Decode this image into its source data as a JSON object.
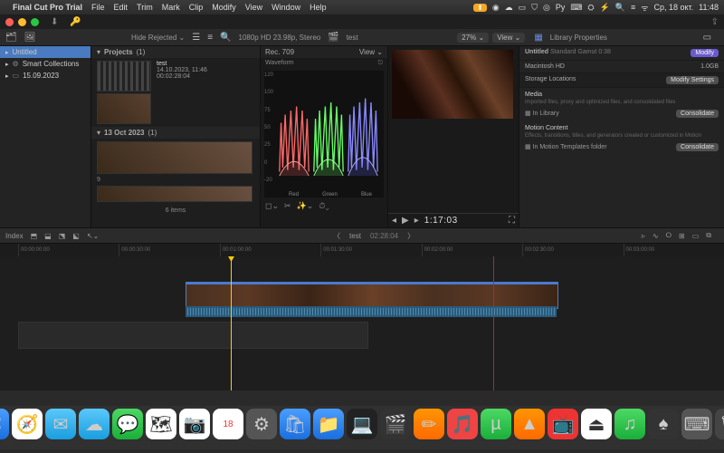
{
  "menubar": {
    "app": "Final Cut Pro Trial",
    "items": [
      "File",
      "Edit",
      "Trim",
      "Mark",
      "Clip",
      "Modify",
      "View",
      "Window",
      "Help"
    ],
    "right_icons": [
      "⬆",
      "◉",
      "☁",
      "▭",
      "⛉",
      "◎",
      "Py",
      "⌨",
      "⛭",
      "⚡",
      "🔍",
      "≡",
      "ᯤ"
    ],
    "date": "Ср, 18 окт.",
    "time": "11:48"
  },
  "toolbar": {
    "hide_rejected": "Hide Rejected",
    "format": "1080p HD 23.98p, Stereo",
    "project_label": "test",
    "zoom": "27%",
    "view_btn": "View",
    "library_props": "Library Properties"
  },
  "sidebar": {
    "items": [
      {
        "icon": "▸",
        "label": "Untitled"
      },
      {
        "icon": "▸",
        "label": "Smart Collections"
      },
      {
        "icon": "▸",
        "label": "15.09.2023"
      }
    ]
  },
  "browser": {
    "projects_head": "Projects",
    "projects_count": "(1)",
    "clip_name": "test",
    "clip_date": "14.10.2023, 11:46",
    "clip_dur": "00:02:28:04",
    "date_head": "13 Oct 2023",
    "date_count": "(1)",
    "footer": "6 items"
  },
  "scopes": {
    "title": "Rec. 709",
    "view": "View",
    "sub": "Waveform",
    "axis": [
      "120",
      "100",
      "75",
      "50",
      "25",
      "0",
      "-20"
    ],
    "labels": [
      "Red",
      "Green",
      "Blue"
    ]
  },
  "viewer": {
    "timecode": "1:17:03",
    "play": "▶"
  },
  "inspector": {
    "name": "Untitled",
    "gamut": "Standard Gamut 0:38",
    "modify": "Modify",
    "storage_name": "Macintosh HD",
    "storage_size": "1.0GB",
    "storage_loc": "Storage Locations",
    "modify_settings": "Modify Settings",
    "media_h": "Media",
    "media_s": "Imported files, proxy and optimized files, and consolidated files",
    "in_library": "In Library",
    "consolidate": "Consolidate",
    "motion_h": "Motion Content",
    "motion_s": "Effects, transitions, titles, and generators created or customized in Motion",
    "motion_loc": "In Motion Templates folder"
  },
  "tlbar": {
    "index": "Index",
    "name": "test",
    "dur": "02:28:04"
  },
  "ruler": [
    "00:00:00:00",
    "00:00:30:00",
    "00:01:00:00",
    "00:01:30:00",
    "00:02:00:00",
    "00:02:30:00",
    "00:03:00:00"
  ],
  "dock": [
    "⌘",
    "🧭",
    "✉",
    "☁",
    "💬",
    "🗺",
    "📷",
    "🗓",
    "⚙",
    "🛍",
    "📁",
    "💻",
    "🎬",
    "✏",
    "🎵",
    "µ",
    "▲",
    "📺",
    "⏏",
    "♫",
    "♠",
    "⌨",
    "🗑"
  ]
}
